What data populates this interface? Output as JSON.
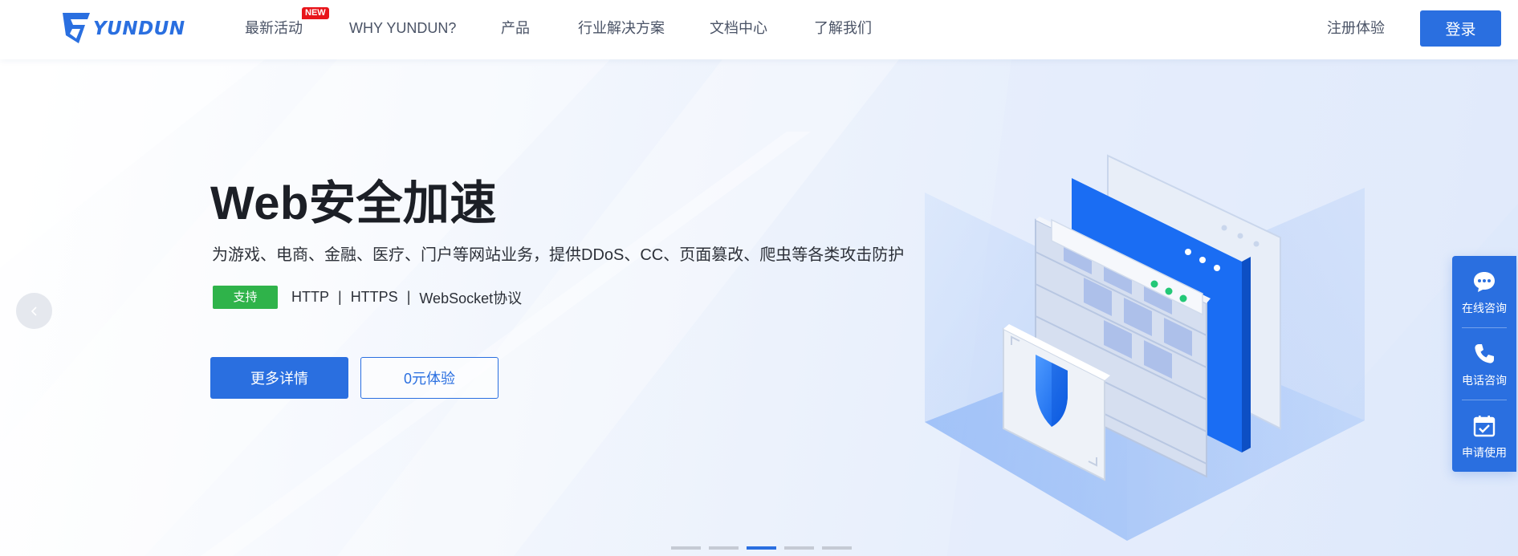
{
  "header": {
    "logo_text": "YUNDUN",
    "nav": [
      {
        "label": "最新活动"
      },
      {
        "label": "WHY YUNDUN?"
      },
      {
        "label": "产品"
      },
      {
        "label": "行业解决方案"
      },
      {
        "label": "文档中心"
      },
      {
        "label": "了解我们"
      }
    ],
    "new_badge": "NEW",
    "register_label": "注册体验",
    "login_label": "登录"
  },
  "hero": {
    "title": "Web安全加速",
    "description": "为游戏、电商、金融、医疗、门户等网站业务，提供DDoS、CC、页面篡改、爬虫等各类攻击防护",
    "support_label": "支持",
    "protocols": [
      "HTTP",
      "HTTPS",
      "WebSocket协议"
    ],
    "separator": "|",
    "detail_button": "更多详情",
    "trial_button": "0元体验",
    "slide_count": 5,
    "active_slide": 3
  },
  "float_panel": {
    "items": [
      {
        "label": "在线咨询",
        "icon": "chat-icon"
      },
      {
        "label": "电话咨询",
        "icon": "phone-icon"
      },
      {
        "label": "申请使用",
        "icon": "calendar-check-icon"
      }
    ]
  },
  "colors": {
    "brand_blue": "#2a6fe0",
    "support_green": "#2fb34a",
    "badge_red": "#e8141a"
  }
}
